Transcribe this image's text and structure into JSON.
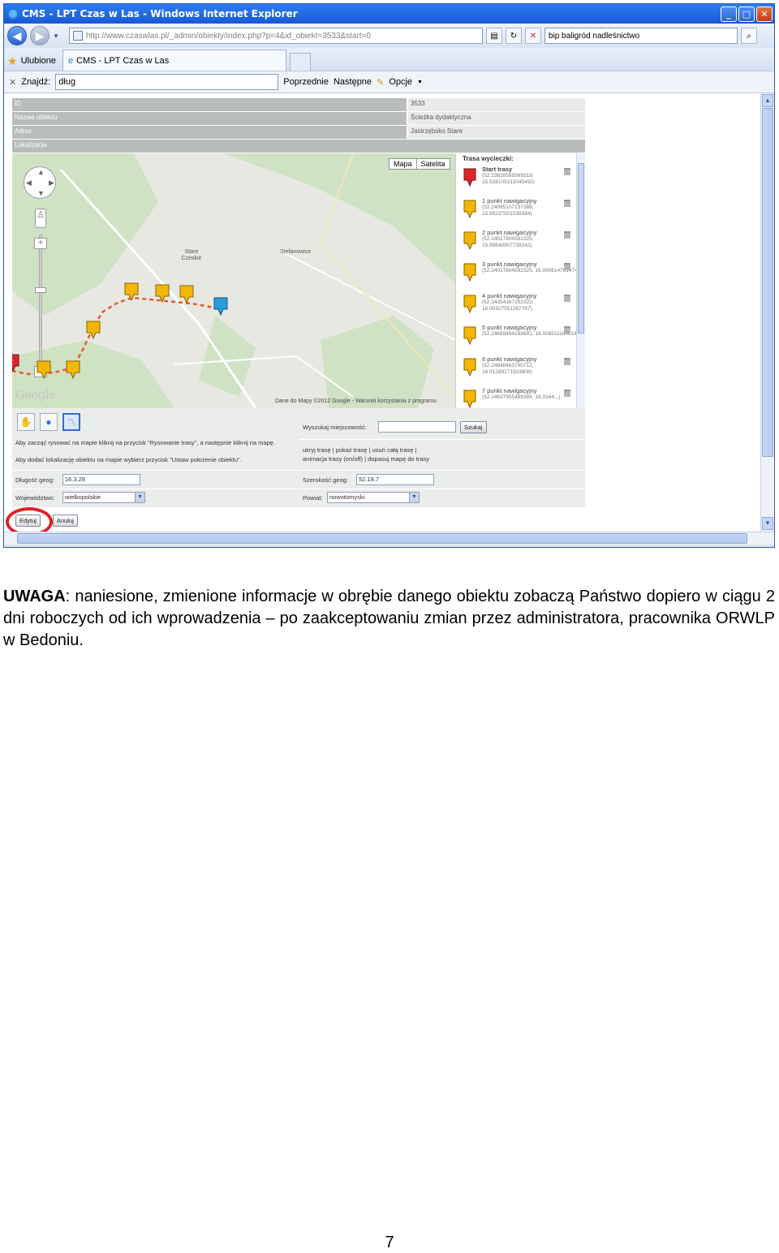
{
  "window": {
    "title": "CMS - LPT Czas w Las - Windows Internet Explorer",
    "address": "http://www.czaswlas.pl/_admin/obiekty/index.php?p=4&id_obiekt=3533&start=0",
    "search_text": "bip baligród nadleśnictwo",
    "favorites_label": "Ulubione",
    "tab_label": "CMS - LPT Czas w Las",
    "find_label": "Znajdź:",
    "find_value": "dług",
    "find_prev": "Poprzednie",
    "find_next": "Następne",
    "find_options": "Opcje"
  },
  "form": {
    "rows": [
      {
        "label": "ID",
        "value": "3533"
      },
      {
        "label": "Nazwa obiektu",
        "value": "Ścieżka dydaktyczna"
      },
      {
        "label": "Adres",
        "value": "Jastrzębsko Stare"
      },
      {
        "label": "Lokalizacja",
        "value": ""
      }
    ]
  },
  "map": {
    "type_map": "Mapa",
    "type_satellite": "Satelita",
    "place_1": "Stare Czeskie",
    "place_2": "Stefanowice",
    "google": "Google",
    "copyright": "Dane do Mapy ©2012 Google - Warunki korzystania z programu"
  },
  "route": {
    "title": "Trasa wycieczki:",
    "items": [
      {
        "label": "Start trasy",
        "coords": "(52.23828589369319, 15.938105311045492)"
      },
      {
        "label": "1 punkt nawigacyjny",
        "coords": "(52.24065107137388, 15.99237501538384)"
      },
      {
        "label": "2 punkt nawigacyjny",
        "coords": "(52.24017804592325, 15.99640907739242)"
      },
      {
        "label": "3 punkt nawigacyjny",
        "coords": "(52.24017804592325, 16.0006147614744)"
      },
      {
        "label": "4 punkt nawigacyjny",
        "coords": "(52.24354167292322, 16.00327551267767)"
      },
      {
        "label": "5 punkt nawigacyjny",
        "coords": "(52.24669484168681, 16.00851118481443)"
      },
      {
        "label": "6 punkt nawigacyjny",
        "coords": "(52.24648463740712, 16.01289271923806)"
      },
      {
        "label": "7 punkt nawigacyjny",
        "coords": "(52.24637955489384, 16.0164...)"
      }
    ]
  },
  "tools": {
    "hint": "Aby zacząć rysować na mapie kliknij na przycisk \"Rysowanie trasy\", a następnie kliknij na mapę.",
    "hint2": "Aby dodać lokalizację obiektu na mapie wybierz przycisk \"Ustaw położenie obiektu\".",
    "search_label": "Wyszukaj miejscowość:",
    "search_button": "Szukaj",
    "route_links": "ukryj trasę | pokaż trasę | usuń całą trasę |",
    "route_links2": "animacja trasy (on/off) | dopasuj mapę do trasy",
    "lon_label": "Długość geog:",
    "lon_value": "16.3.28",
    "lat_label": "Szerokość geog:",
    "lat_value": "52.18.7",
    "voiv_label": "Województwo:",
    "voiv_value": "wielkopolskie",
    "county_label": "Powiat:",
    "county_value": "nowotomyski",
    "edit_button": "Edytuj",
    "cancel_button": "Anuluj"
  },
  "note": {
    "bold": "UWAGA",
    "text": ": naniesione, zmienione informacje w obrębie danego obiektu zobaczą Państwo dopiero w ciągu 2 dni roboczych od ich wprowadzenia – po zaakceptowaniu zmian przez administratora, pracownika ORWLP w Bedoniu."
  },
  "page_number": "7",
  "colors": {
    "route_line": "#e8592a",
    "marker_yellow": "#f2b705",
    "marker_red": "#d9262c",
    "marker_blue": "#2a9be0",
    "highlight": "#e12027"
  }
}
